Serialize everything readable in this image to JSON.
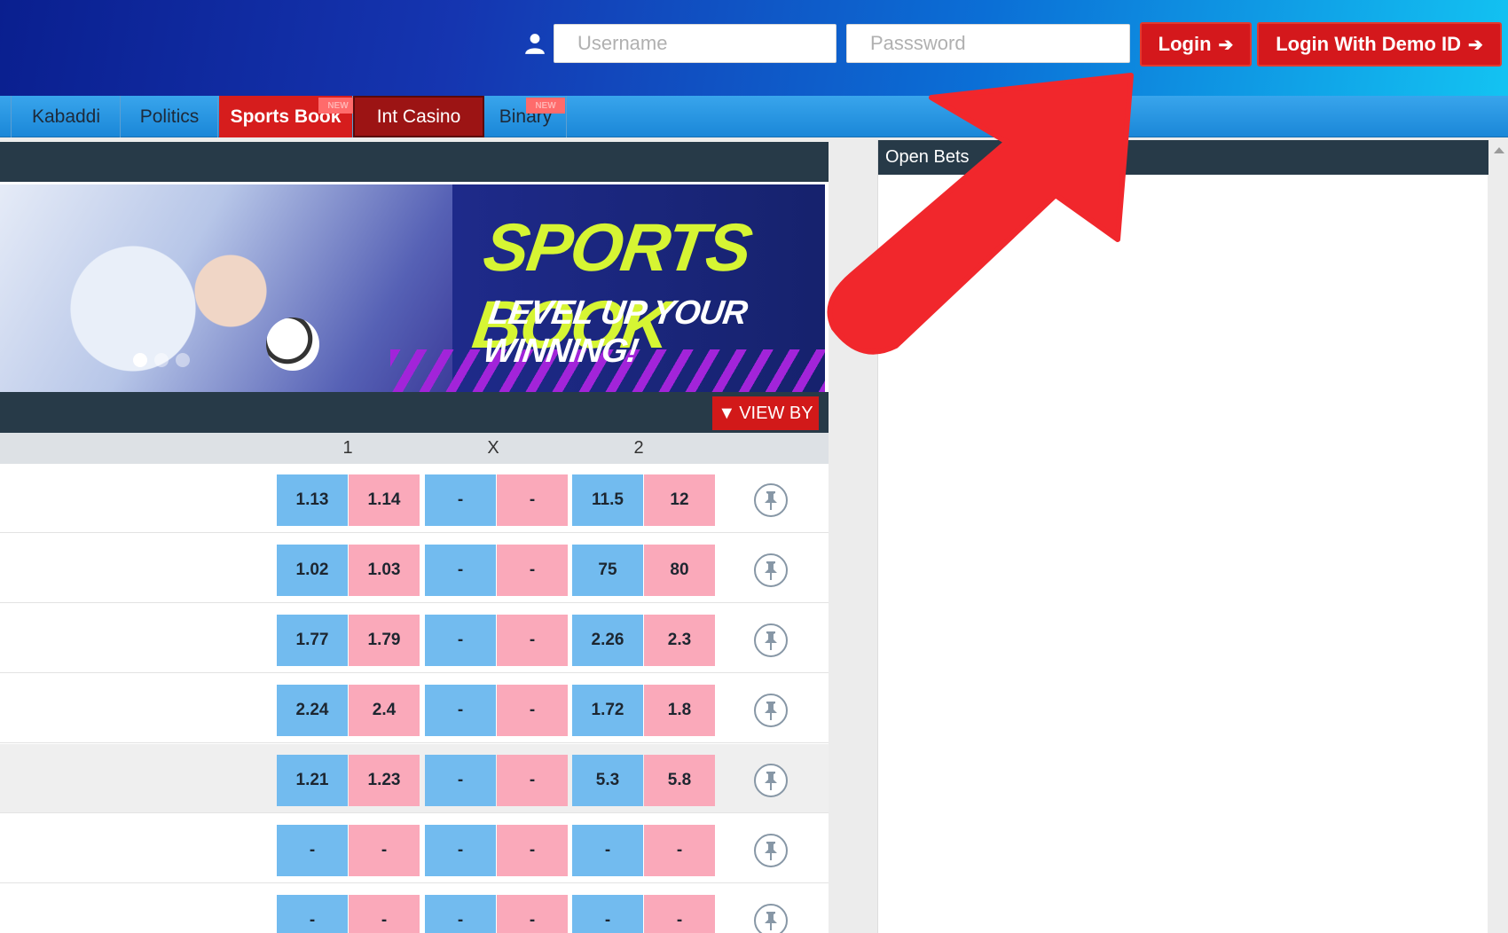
{
  "header": {
    "username_placeholder": "Username",
    "password_placeholder": "Passsword",
    "login_label": "Login",
    "demo_label": "Login With Demo ID",
    "arrow_icon": "arrow-right-icon"
  },
  "nav": {
    "items": [
      {
        "label": "Kabaddi"
      },
      {
        "label": "Politics"
      },
      {
        "label": "Sports Book",
        "badge": "NEW"
      },
      {
        "label": "Int Casino"
      },
      {
        "label": "Binary",
        "badge": "NEW"
      }
    ]
  },
  "banner": {
    "title": "SPORTS BOOK",
    "subtitle": "LEVEL UP YOUR WINNING!"
  },
  "market": {
    "view_by_label": "VIEW BY",
    "columns": [
      "1",
      "X",
      "2"
    ],
    "rows": [
      [
        "1.13",
        "1.14",
        "-",
        "-",
        "11.5",
        "12"
      ],
      [
        "1.02",
        "1.03",
        "-",
        "-",
        "75",
        "80"
      ],
      [
        "1.77",
        "1.79",
        "-",
        "-",
        "2.26",
        "2.3"
      ],
      [
        "2.24",
        "2.4",
        "-",
        "-",
        "1.72",
        "1.8"
      ],
      [
        "1.21",
        "1.23",
        "-",
        "-",
        "5.3",
        "5.8"
      ],
      [
        "-",
        "-",
        "-",
        "-",
        "-",
        "-"
      ],
      [
        "-",
        "-",
        "-",
        "-",
        "-",
        "-"
      ]
    ]
  },
  "right_panel": {
    "title": "Open Bets"
  },
  "colors": {
    "back": "#72bbef",
    "lay": "#faa9ba",
    "accent_red": "#d4181c",
    "dark_bar": "#273a48"
  }
}
